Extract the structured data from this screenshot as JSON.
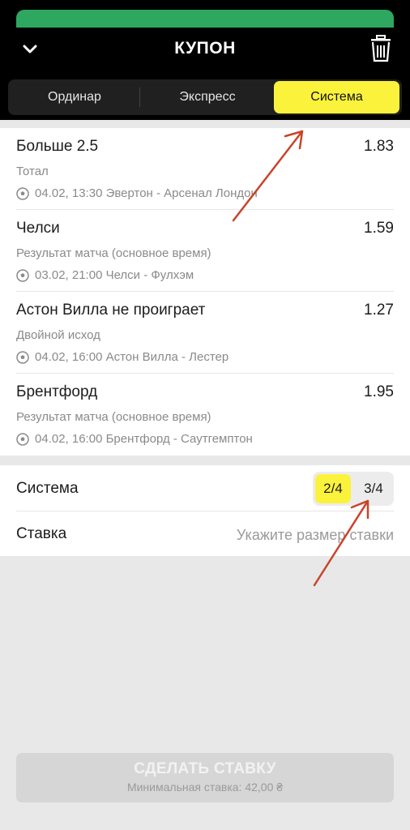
{
  "header": {
    "title": "КУПОН"
  },
  "tabs": [
    {
      "label": "Ординар",
      "active": false
    },
    {
      "label": "Экспресс",
      "active": false
    },
    {
      "label": "Система",
      "active": true
    }
  ],
  "bets": [
    {
      "name": "Больше  2.5",
      "odds": "1.83",
      "market": "Тотал",
      "event": "04.02, 13:30 Эвертон - Арсенал Лондон"
    },
    {
      "name": "Челси",
      "odds": "1.59",
      "market": "Результат матча (основное время)",
      "event": "03.02, 21:00 Челси - Фулхэм"
    },
    {
      "name": "Астон Вилла не проиграет",
      "odds": "1.27",
      "market": "Двойной исход",
      "event": "04.02, 16:00 Астон Вилла - Лестер"
    },
    {
      "name": "Брентфорд",
      "odds": "1.95",
      "market": "Результат матча (основное время)",
      "event": "04.02, 16:00 Брентфорд - Саутгемптон"
    }
  ],
  "system": {
    "label": "Система",
    "options": [
      "2/4",
      "3/4"
    ],
    "selected": "2/4"
  },
  "stake": {
    "label": "Ставка",
    "placeholder": "Укажите размер ставки",
    "value": ""
  },
  "submit": {
    "label": "СДЕЛАТЬ СТАВКУ",
    "min_stake": "Минимальная ставка: 42,00 ₴"
  },
  "colors": {
    "accent_yellow": "#fbf23c",
    "header_bg": "#000000",
    "top_strip_green": "#2ea760",
    "annotation_arrow": "#c8442a"
  },
  "icons": [
    "chevron-down-icon",
    "trash-icon",
    "soccer-ball-icon"
  ]
}
